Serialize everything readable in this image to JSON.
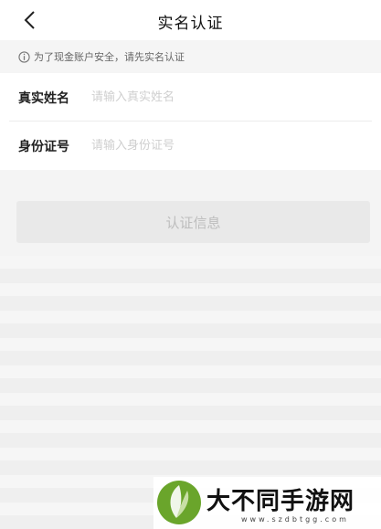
{
  "header": {
    "title": "实名认证",
    "back_icon": "chevron-left-icon"
  },
  "notice": {
    "icon": "info-icon",
    "text": "为了现金账户安全，请先实名认证"
  },
  "form": {
    "name_label": "真实姓名",
    "name_placeholder": "请输入真实姓名",
    "name_value": "",
    "id_label": "身份证号",
    "id_placeholder": "请输入身份证号",
    "id_value": ""
  },
  "submit_label": "认证信息",
  "watermark": {
    "text": "大不同手游网",
    "url": "www.szdbtgg.com"
  },
  "colors": {
    "accent_green": "#6aa52b",
    "button_bg": "#e9e9e9",
    "button_text": "#bdbdbd"
  }
}
